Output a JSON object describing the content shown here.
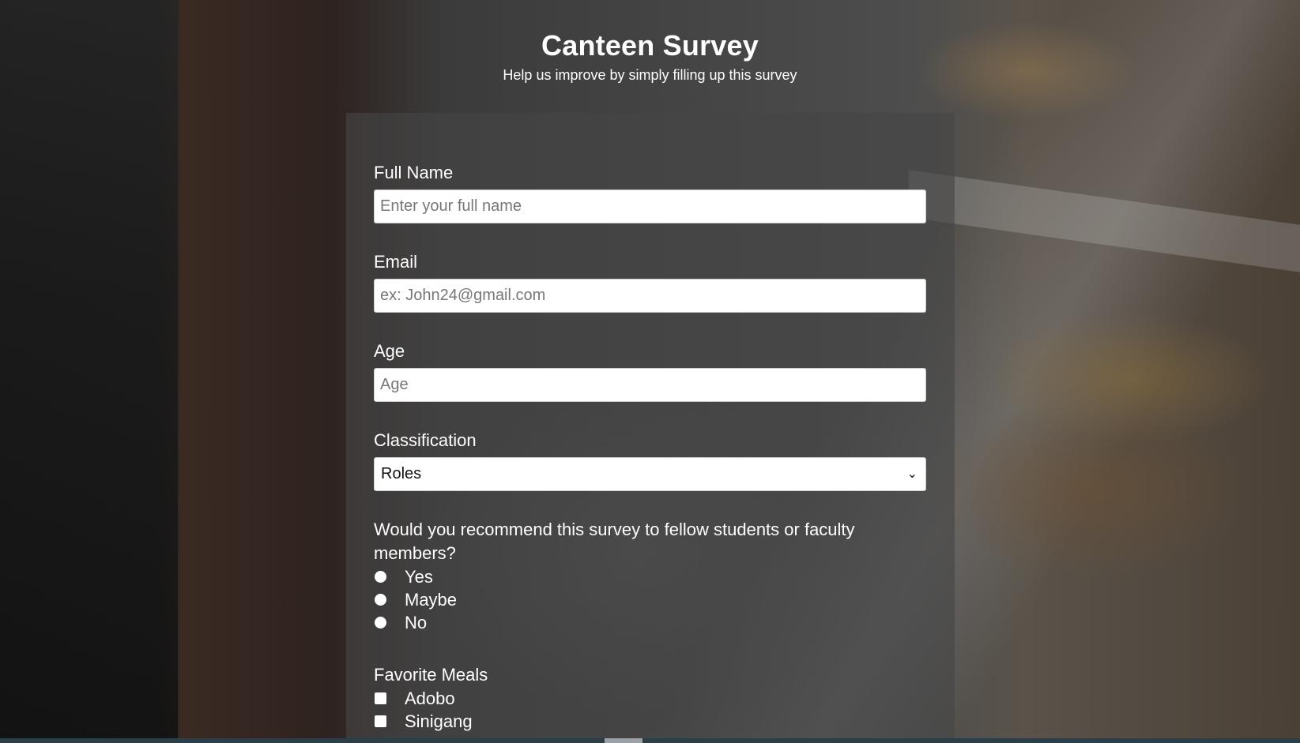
{
  "header": {
    "title": "Canteen Survey",
    "subtitle": "Help us improve by simply filling up this survey"
  },
  "form": {
    "full_name": {
      "label": "Full Name",
      "placeholder": "Enter your full name"
    },
    "email": {
      "label": "Email",
      "placeholder": "ex: John24@gmail.com"
    },
    "age": {
      "label": "Age",
      "placeholder": "Age"
    },
    "classification": {
      "label": "Classification",
      "selected": "Roles",
      "chevron_icon": "chevron-down-icon"
    },
    "recommend": {
      "question": "Would you recommend this survey to fellow students or faculty members?",
      "options": [
        "Yes",
        "Maybe",
        "No"
      ]
    },
    "favorite_meals": {
      "label": "Favorite Meals",
      "options": [
        "Adobo",
        "Sinigang"
      ]
    }
  },
  "colors": {
    "panel": "#464646",
    "text": "#ffffff",
    "input_bg": "#ffffff",
    "scrollbar_track": "#2c3e48"
  }
}
